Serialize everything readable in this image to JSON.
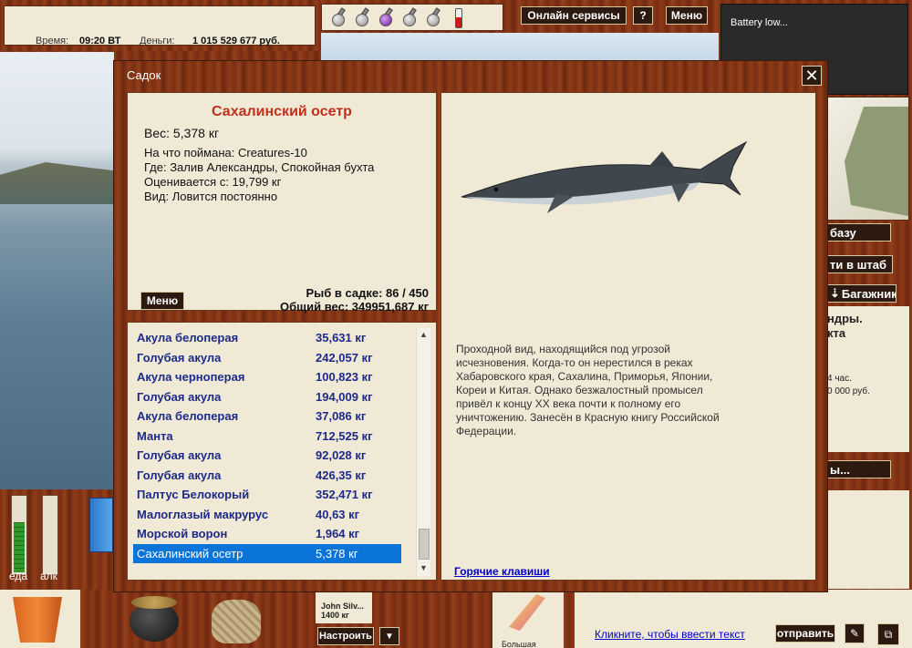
{
  "status": {
    "time_label": "Время:",
    "time_value": "09:20 ВТ",
    "money_label": "Деньги:",
    "money_value": "1 015 529 677 руб."
  },
  "header": {
    "online_services": "Онлайн сервисы",
    "help": "?",
    "menu": "Меню"
  },
  "notification": {
    "text": "Battery low..."
  },
  "sidebar_right": {
    "btn_base": "базу",
    "btn_hq": "ти в штаб",
    "btn_trunk": "Багажник",
    "info_title": "ндры.",
    "info_title2": "кта",
    "info_line1": "4 час.",
    "info_line2": "0 000 руб.",
    "btn_more": "ы..."
  },
  "meters": {
    "food_label": "еда",
    "alcohol_label": "алк",
    "food_level": 0.65,
    "alcohol_level": 0.0
  },
  "bottom": {
    "lure_name": "John Silv...",
    "lure_weight": "1400 кг",
    "configure": "Настроить",
    "dropdown": "▼",
    "lure2_label": "Большая",
    "chat_prompt": "Кликните, чтобы ввести текст",
    "send": "отправить"
  },
  "dialog": {
    "title": "Садок",
    "close": "✕",
    "fish_name": "Сахалинский осетр",
    "weight": "Вес: 5,378 кг",
    "caught_on": "На что поймана: Creatures-10",
    "location": "Где: Залив Александры, Спокойная бухта",
    "valued": "Оценивается с: 19,799 кг",
    "kind": "Вид: Ловится постоянно",
    "menu_button": "Меню",
    "fish_count": "Рыб в садке: 86 / 450",
    "total_weight": "Общий вес: 349951,687 кг",
    "description": "Проходной вид, находящийся под угрозой\nисчезновения.  Когда-то он нерестился в  реках\nХабаровского края, Сахалина, Приморья, Японии,\nКореи и Китая. Однако безжалостный промысел\nпривёл к концу XX века почти к полному его\nуничтожению. Занесён в Красную книгу Российской\nФедерации.",
    "hotkeys": "Горячие клавиши"
  },
  "catch_list": [
    {
      "name": "Акула белоперая",
      "weight": "35,631 кг"
    },
    {
      "name": "Голубая акула",
      "weight": "242,057 кг"
    },
    {
      "name": "Акула черноперая",
      "weight": "100,823 кг"
    },
    {
      "name": "Голубая акула",
      "weight": "194,009 кг"
    },
    {
      "name": "Акула белоперая",
      "weight": "37,086 кг"
    },
    {
      "name": "Манта",
      "weight": "712,525 кг"
    },
    {
      "name": "Голубая акула",
      "weight": "92,028 кг"
    },
    {
      "name": "Голубая акула",
      "weight": "426,35 кг"
    },
    {
      "name": "Палтус Белокорый",
      "weight": "352,471 кг"
    },
    {
      "name": "Малоглазый макрурус",
      "weight": "40,63 кг"
    },
    {
      "name": "Морской ворон",
      "weight": "1,964 кг"
    },
    {
      "name": "Сахалинский осетр",
      "weight": "5,378 кг"
    }
  ],
  "colors": {
    "fish_name": "#c0301a",
    "list_text": "#1d2a8a",
    "selection": "#0a74d8"
  }
}
